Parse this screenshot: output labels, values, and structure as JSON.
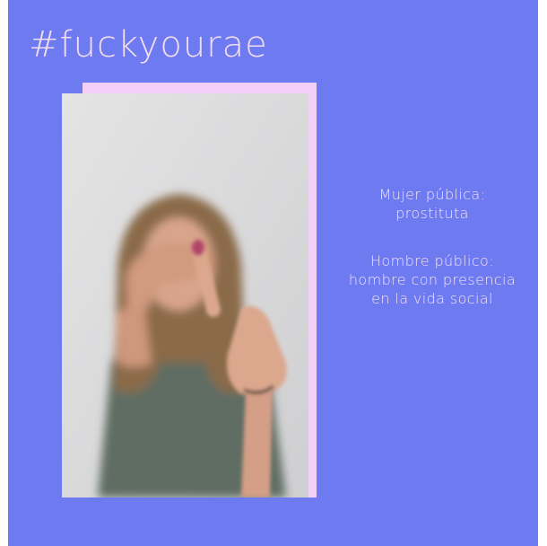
{
  "post": {
    "hashtag": "#fuckyourae",
    "definitions": [
      {
        "term_line": "Mujer pública:",
        "meaning_lines": [
          "prostituta"
        ]
      },
      {
        "term_line": "Hombre público:",
        "meaning_lines": [
          "hombre con presencia",
          "en la vida social"
        ]
      }
    ]
  },
  "colors": {
    "background": "#6E7BF0",
    "frame_accent": "#F2CFF6",
    "text": "#F3E2F6"
  },
  "photo": {
    "subject": "woman covering her eyes with one hand and showing the middle finger with the other"
  }
}
